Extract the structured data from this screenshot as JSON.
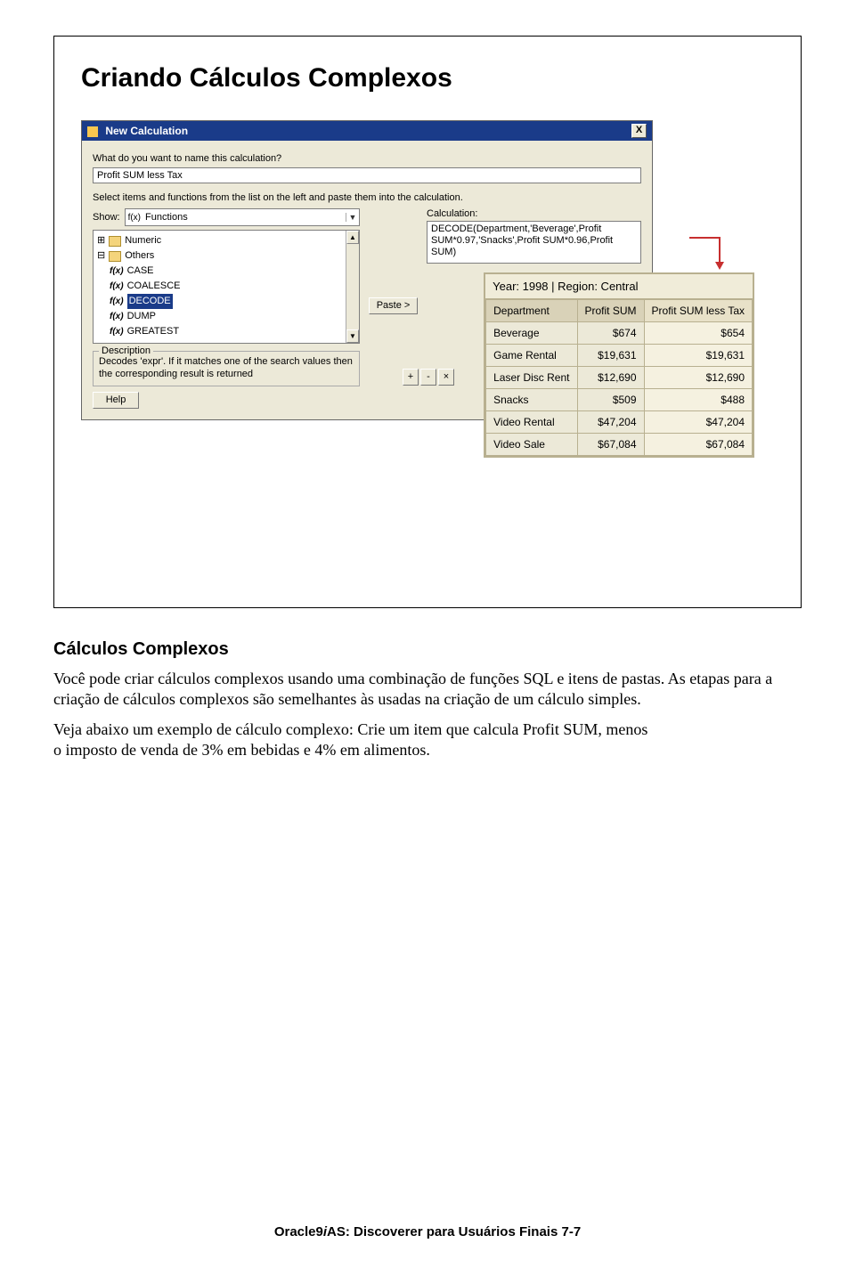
{
  "slide": {
    "title": "Criando Cálculos Complexos",
    "dialog": {
      "window_title": "New Calculation",
      "close_label": "X",
      "name_prompt": "What do you want to name this calculation?",
      "name_value": "Profit SUM less Tax",
      "select_prompt": "Select items and functions from the list on the left and paste them into the calculation.",
      "show_label": "Show:",
      "show_value": "Functions",
      "show_fx": "f(x)",
      "calc_label": "Calculation:",
      "calc_value": "DECODE(Department,'Beverage',Profit SUM*0.97,'Snacks',Profit SUM*0.96,Profit SUM)",
      "paste_label": "Paste >",
      "tree": {
        "numeric": "Numeric",
        "others": "Others",
        "items": [
          "CASE",
          "COALESCE",
          "DECODE",
          "DUMP",
          "GREATEST"
        ],
        "fx": "f(x)",
        "expand_plus": "⊞",
        "expand_minus": "⊟"
      },
      "description": {
        "legend": "Description",
        "text": "Decodes 'expr'. If it matches one of the search values then the corresponding result is returned"
      },
      "ops": {
        "plus": "+",
        "minus": "-",
        "mult": "×"
      },
      "help_label": "Help"
    },
    "result": {
      "header": "Year: 1998 | Region: Central",
      "cols": [
        "Department",
        "Profit SUM",
        "Profit SUM less Tax"
      ],
      "rows": [
        {
          "dept": "Beverage",
          "sum": "$674",
          "less": "$654"
        },
        {
          "dept": "Game Rental",
          "sum": "$19,631",
          "less": "$19,631"
        },
        {
          "dept": "Laser Disc Rent",
          "sum": "$12,690",
          "less": "$12,690"
        },
        {
          "dept": "Snacks",
          "sum": "$509",
          "less": "$488"
        },
        {
          "dept": "Video Rental",
          "sum": "$47,204",
          "less": "$47,204"
        },
        {
          "dept": "Video Sale",
          "sum": "$67,084",
          "less": "$67,084"
        }
      ]
    }
  },
  "body": {
    "heading": "Cálculos Complexos",
    "p1": "Você pode criar cálculos complexos usando uma combinação de funções SQL e itens de pastas. As etapas para a criação de cálculos complexos são semelhantes às usadas na criação de um cálculo simples.",
    "p2": "Veja abaixo um exemplo de cálculo complexo: Crie um item que calcula Profit SUM, menos",
    "p3": "o imposto de venda de 3% em bebidas e 4% em alimentos."
  },
  "footer": {
    "product_a": "Oracle9",
    "product_i": "i",
    "product_b": "AS: Discoverer para Usuários Finais  7-7"
  }
}
